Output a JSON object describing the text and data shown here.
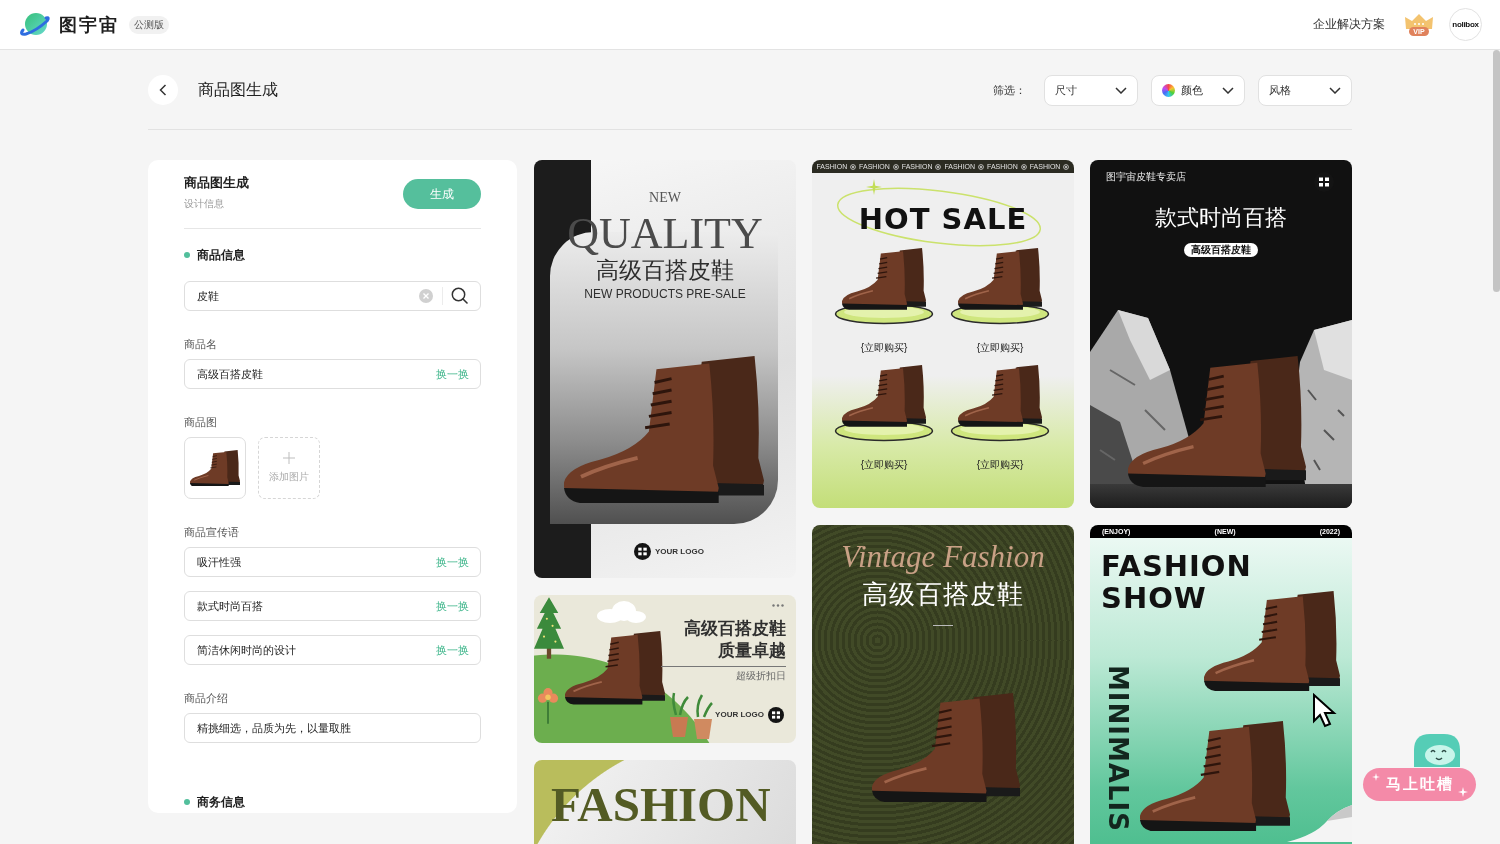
{
  "header": {
    "brand": "图宇宙",
    "badge": "公测版",
    "link": "企业解决方案",
    "vip_label": "VIP",
    "avatar_text": "nolibox"
  },
  "page": {
    "title": "商品图生成",
    "filter_label": "筛选：",
    "filters": [
      {
        "label": "尺寸",
        "kind": "plain"
      },
      {
        "label": "颜色",
        "kind": "color"
      },
      {
        "label": "风格",
        "kind": "plain"
      }
    ]
  },
  "form": {
    "title": "商品图生成",
    "subtitle": "设计信息",
    "submit": "生成",
    "sections": [
      {
        "title": "商品信息",
        "search": {
          "value": "皮鞋"
        },
        "fields": [
          {
            "kind": "inputs",
            "label": "商品名",
            "inputs": [
              {
                "value": "高级百搭皮鞋",
                "action": "换一换"
              }
            ]
          },
          {
            "kind": "images",
            "label": "商品图",
            "add_label": "添加图片"
          },
          {
            "kind": "inputs",
            "label": "商品宣传语",
            "inputs": [
              {
                "value": "吸汗性强",
                "action": "换一换"
              },
              {
                "value": "款式时尚百搭",
                "action": "换一换"
              },
              {
                "value": "简洁休闲时尚的设计",
                "action": "换一换"
              }
            ]
          },
          {
            "kind": "inputs",
            "label": "商品介绍",
            "inputs": [
              {
                "value": "精挑细选，品质为先，以量取胜"
              }
            ]
          }
        ]
      },
      {
        "title": "商务信息"
      }
    ]
  },
  "results": {
    "columns": [
      [
        {
          "kind": "quality",
          "kicker": "NEW",
          "headline": "QUALITY",
          "title": "高级百搭皮鞋",
          "subtitle": "NEW PRODUCTS PRE-SALE",
          "logo_text": "YOUR LOGO"
        },
        {
          "kind": "landscape",
          "lines": [
            "高级百搭皮鞋",
            "质量卓越"
          ],
          "note": "超级折扣日",
          "logo_text": "YOUR LOGO"
        },
        {
          "kind": "fashion",
          "headline": "FASHION"
        }
      ],
      [
        {
          "kind": "hotsale",
          "ticker": [
            "FASHION",
            "FASHION",
            "FASHION",
            "FASHION",
            "FASHION",
            "FASHION"
          ],
          "headline": "HOT SALE",
          "products": [
            "{立即购买}",
            "{立即购买}",
            "{立即购买}",
            "{立即购买}"
          ]
        },
        {
          "kind": "vintage",
          "script": "Vintage Fashion",
          "title": "高级百搭皮鞋"
        }
      ],
      [
        {
          "kind": "store",
          "store_name": "图宇宙皮鞋专卖店",
          "title": "款式时尚百搭",
          "tag": "高级百搭皮鞋"
        },
        {
          "kind": "show",
          "top_bar": [
            "(ENJOY)",
            "(NEW)",
            "(2022)"
          ],
          "headline": [
            "FASHION",
            "SHOW"
          ],
          "vertical": "MINIMALIS"
        }
      ]
    ]
  },
  "feedback": {
    "label": "马上吐槽"
  }
}
